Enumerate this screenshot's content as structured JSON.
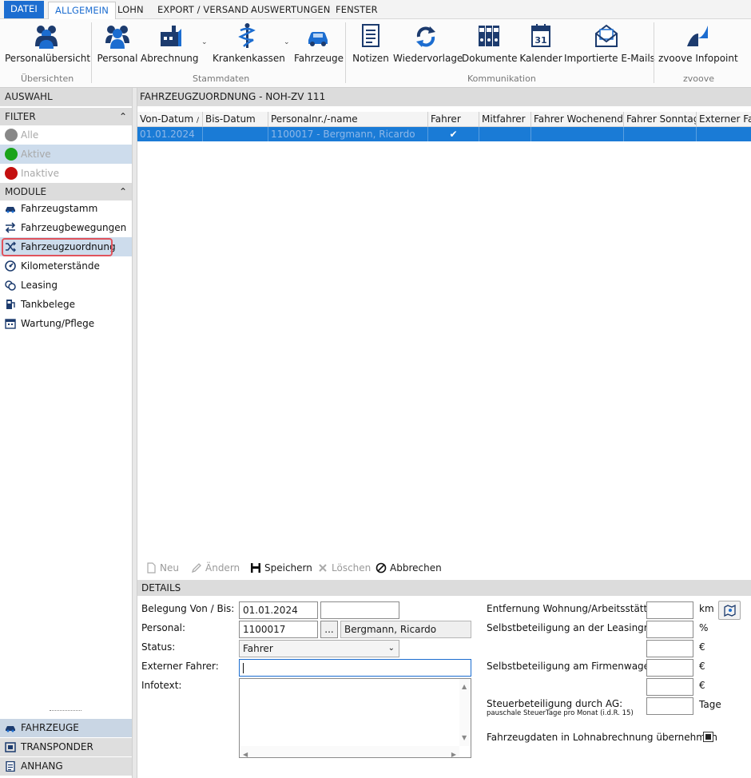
{
  "menu": {
    "tabs": [
      "DATEI",
      "ALLGEMEIN",
      "LOHN",
      "EXPORT / VERSAND",
      "AUSWERTUNGEN",
      "FENSTER"
    ]
  },
  "ribbon": {
    "buttons": {
      "personaluebersicht": "Personalübersicht",
      "personal": "Personal",
      "abrechnung": "Abrechnung",
      "krankenkassen": "Krankenkassen",
      "fahrzeuge": "Fahrzeuge",
      "notizen": "Notizen",
      "wiedervorlage": "Wiedervorlage",
      "dokumente": "Dokumente",
      "kalender": "Kalender",
      "emails": "Importierte E-Mails",
      "infopoint": "zvoove Infopoint"
    },
    "groups": {
      "uebersichten": "Übersichten",
      "stammdaten": "Stammdaten",
      "kommunikation": "Kommunikation",
      "zvoove": "zvoove"
    },
    "calendar_day": "31"
  },
  "left": {
    "auswahl": "AUSWAHL",
    "filter_title": "FILTER",
    "filters": [
      "Alle",
      "Aktive",
      "Inaktive"
    ],
    "module_title": "MODULE",
    "modules": [
      "Fahrzeugstamm",
      "Fahrzeugbewegungen",
      "Fahrzeugzuordnung",
      "Kilometerstände",
      "Leasing",
      "Tankbelege",
      "Wartung/Pflege"
    ],
    "bottom": [
      "FAHRZEUGE",
      "TRANSPONDER",
      "ANHANG"
    ]
  },
  "main": {
    "title": "FAHRZEUGZUORDNUNG - NOH-ZV 111",
    "columns": [
      "Von-Datum",
      "Bis-Datum",
      "Personalnr./-name",
      "Fahrer",
      "Mitfahrer",
      "Fahrer Wochenende",
      "Fahrer Sonntag",
      "Externer Fahrer"
    ],
    "sort_indicator": "/",
    "rows": [
      {
        "von": "01.01.2024",
        "bis": "",
        "personal": "1100017 - Bergmann, Ricardo",
        "fahrer": "✔"
      }
    ]
  },
  "toolbar": {
    "neu": "Neu",
    "aendern": "Ändern",
    "speichern": "Speichern",
    "loeschen": "Löschen",
    "abbrechen": "Abbrechen"
  },
  "details": {
    "title": "DETAILS",
    "belegung_label": "Belegung Von / Bis:",
    "belegung_von": "01.01.2024",
    "belegung_bis": "",
    "personal_label": "Personal:",
    "personal_nr": "1100017",
    "personal_lookup": "...",
    "personal_name": "Bergmann, Ricardo",
    "status_label": "Status:",
    "status_value": "Fahrer",
    "extern_label": "Externer Fahrer:",
    "extern_value": "",
    "infotext_label": "Infotext:",
    "entfernung_label": "Entfernung Wohnung/Arbeitsstätte:",
    "entfernung_unit": "km",
    "leasing_label": "Selbstbeteiligung an der Leasingrate:",
    "leasing_unit1": "%",
    "leasing_unit2": "€",
    "firmenwagen_label": "Selbstbeteiligung am Firmenwagen:",
    "firmenwagen_unit1": "€",
    "firmenwagen_unit2": "€",
    "steuer_label": "Steuerbeteiligung durch AG:",
    "steuer_sub": "pauschale SteuerTage pro Monat (i.d.R. 15)",
    "steuer_unit": "Tage",
    "lohn_label": "Fahrzeugdaten in Lohnabrechnung übernehmen"
  },
  "colors": {
    "accent": "#1c6dd0",
    "selected_row": "#1a7bd6",
    "highlight_box": "#e0535c",
    "active_green": "#1aa31a",
    "inactive_red": "#c41010",
    "all_grey": "#888888"
  }
}
